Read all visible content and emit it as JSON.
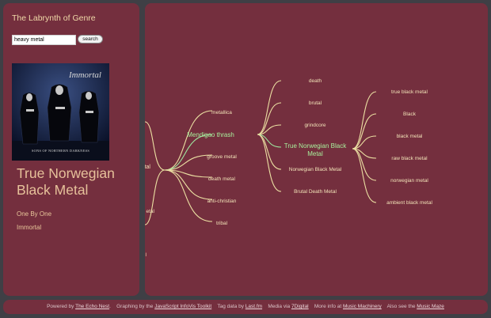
{
  "app": {
    "title": "The Labrynth of Genre"
  },
  "search": {
    "value": "heavy metal",
    "button_label": "search"
  },
  "album": {
    "band_logo": "Immortal",
    "caption": "SONS OF NORTHERN DARKNESS"
  },
  "now_playing": {
    "genre": "True Norwegian Black Metal",
    "track": "One By One",
    "artist": "Immortal"
  },
  "graph": {
    "left_edge_labels": [
      "etal",
      "etal",
      "l"
    ],
    "hub_nodes": [
      "Mendigao thrash",
      "True Norwegian Black Metal"
    ],
    "branch_1": [
      "metallica",
      "groove metal",
      "death metal",
      "anti-christian",
      "tribal"
    ],
    "branch_2": [
      "death",
      "brutal",
      "grindcore",
      "Norwegian Black Metal",
      "Brutal Death Metal"
    ],
    "branch_3": [
      "true black metal",
      "Black",
      "black metal",
      "raw black metal",
      "norwegian metal",
      "ambient black metal"
    ],
    "colors": {
      "edge": "#ece0a3",
      "active_edge": "#9ee8a0",
      "active_label": "#a8ef9c",
      "label": "#f2e3b8"
    }
  },
  "footer": {
    "powered_prefix": "Powered by",
    "powered_link": "The Echo Nest",
    "graphing_prefix": "Graphing by the",
    "graphing_link": "JavaScript InfoVis Toolkit",
    "tag_prefix": "Tag data by",
    "tag_link": "Last.fm",
    "media_prefix": "Media via",
    "media_link": "7Digital",
    "info_prefix": "More info at",
    "info_link": "Music Machinery",
    "maze_prefix": "Also see the",
    "maze_link": "Music Maze"
  }
}
